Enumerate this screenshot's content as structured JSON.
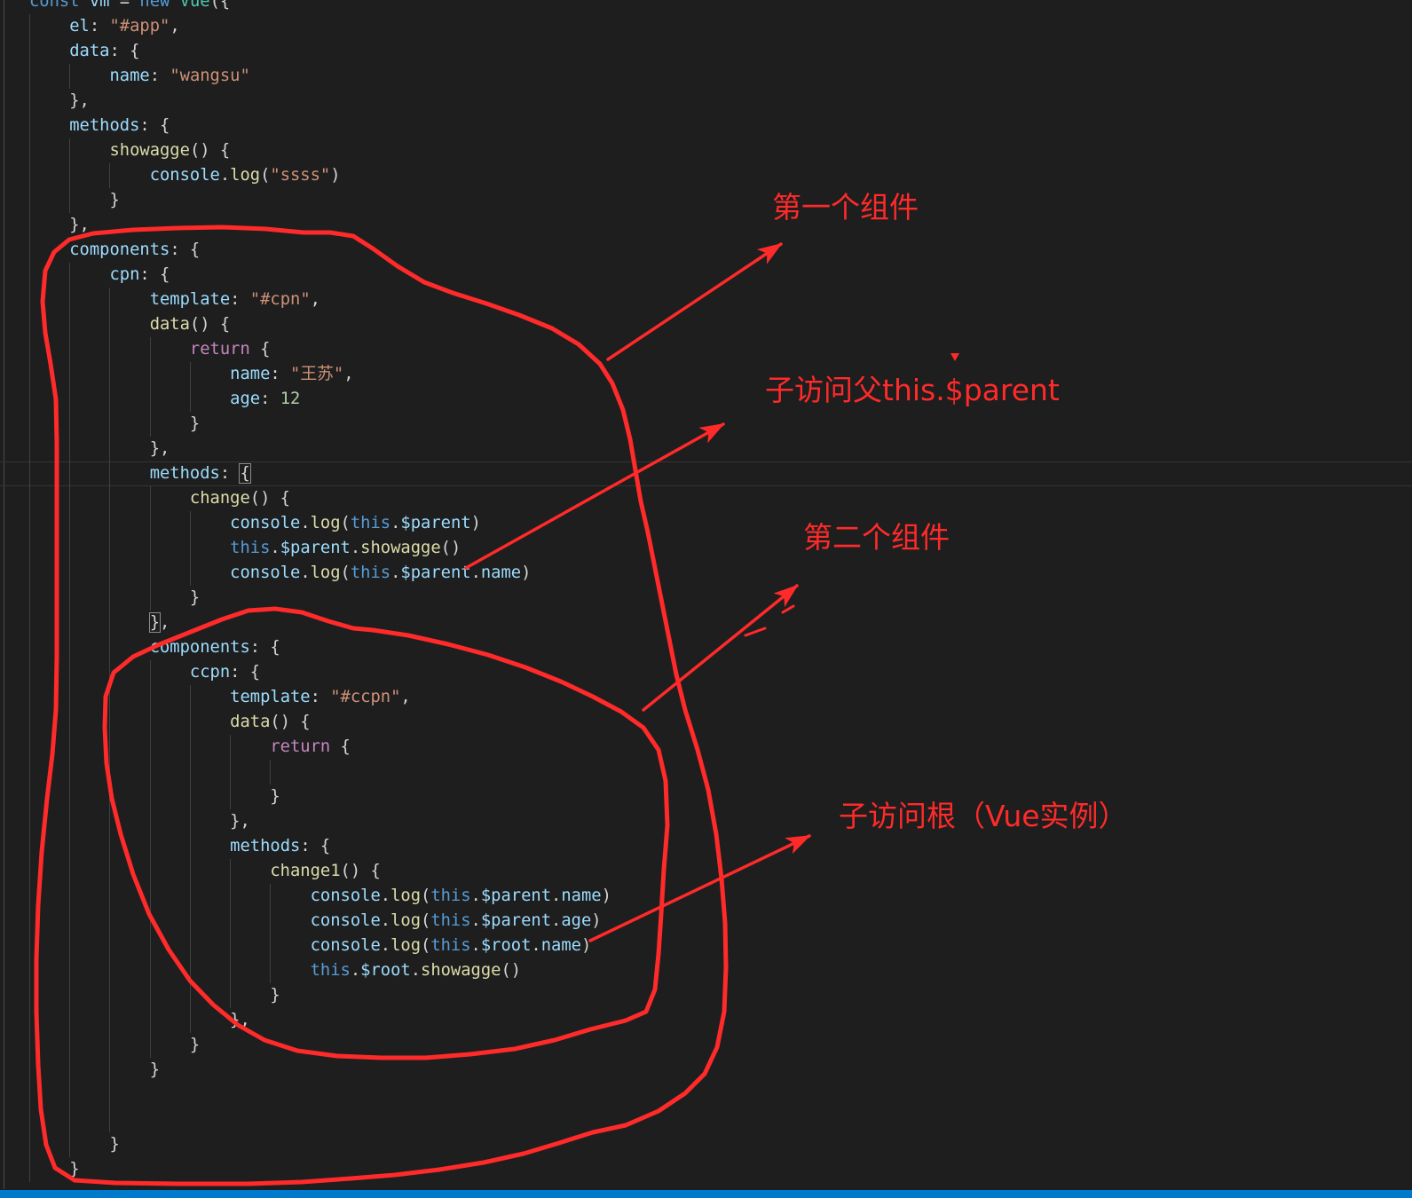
{
  "editor": {
    "theme": {
      "background": "#1e1e1e",
      "keyword": "#569cd6",
      "control": "#c586c0",
      "variable": "#9cdcfe",
      "function": "#dcdcaa",
      "string": "#ce9178",
      "number": "#b5cea8",
      "class": "#4ec9b0",
      "punctuation": "#d4d4d4",
      "indent_guide": "#404040",
      "status_bar": "#007acc"
    },
    "lines": [
      {
        "tokens": [
          {
            "k": "const"
          },
          {
            "p": " "
          },
          {
            "v": "vm"
          },
          {
            "p": " = "
          },
          {
            "k": "new"
          },
          {
            "p": " "
          },
          {
            "cl": "Vue"
          },
          {
            "p": "({"
          }
        ]
      },
      {
        "tokens": [
          {
            "w": "    "
          },
          {
            "v": "el"
          },
          {
            "p": ": "
          },
          {
            "s": "\"#app\""
          },
          {
            "p": ","
          }
        ]
      },
      {
        "tokens": [
          {
            "w": "    "
          },
          {
            "v": "data"
          },
          {
            "p": ": {"
          }
        ]
      },
      {
        "tokens": [
          {
            "w": "        "
          },
          {
            "v": "name"
          },
          {
            "p": ": "
          },
          {
            "s": "\"wangsu\""
          }
        ]
      },
      {
        "tokens": [
          {
            "w": "    "
          },
          {
            "p": "},"
          }
        ]
      },
      {
        "tokens": [
          {
            "w": "    "
          },
          {
            "v": "methods"
          },
          {
            "p": ": {"
          }
        ]
      },
      {
        "tokens": [
          {
            "w": "        "
          },
          {
            "f": "showagge"
          },
          {
            "p": "() {"
          }
        ]
      },
      {
        "tokens": [
          {
            "w": "            "
          },
          {
            "v": "console"
          },
          {
            "p": "."
          },
          {
            "f": "log"
          },
          {
            "p": "("
          },
          {
            "s": "\"ssss\""
          },
          {
            "p": ")"
          }
        ]
      },
      {
        "tokens": [
          {
            "w": "        "
          },
          {
            "p": "}"
          }
        ]
      },
      {
        "tokens": [
          {
            "w": "    "
          },
          {
            "p": "},"
          }
        ]
      },
      {
        "tokens": [
          {
            "w": "    "
          },
          {
            "v": "components"
          },
          {
            "p": ": {"
          }
        ]
      },
      {
        "tokens": [
          {
            "w": "        "
          },
          {
            "v": "cpn"
          },
          {
            "p": ": {"
          }
        ]
      },
      {
        "tokens": [
          {
            "w": "            "
          },
          {
            "v": "template"
          },
          {
            "p": ": "
          },
          {
            "s": "\"#cpn\""
          },
          {
            "p": ","
          }
        ]
      },
      {
        "tokens": [
          {
            "w": "            "
          },
          {
            "f": "data"
          },
          {
            "p": "() {"
          }
        ]
      },
      {
        "tokens": [
          {
            "w": "                "
          },
          {
            "c": "return"
          },
          {
            "p": " {"
          }
        ]
      },
      {
        "tokens": [
          {
            "w": "                    "
          },
          {
            "v": "name"
          },
          {
            "p": ": "
          },
          {
            "s": "\"王苏\""
          },
          {
            "p": ","
          }
        ]
      },
      {
        "tokens": [
          {
            "w": "                    "
          },
          {
            "v": "age"
          },
          {
            "p": ": "
          },
          {
            "n": "12"
          }
        ]
      },
      {
        "tokens": [
          {
            "w": "                "
          },
          {
            "p": "}"
          }
        ]
      },
      {
        "tokens": [
          {
            "w": "            "
          },
          {
            "p": "},"
          }
        ]
      },
      {
        "tokens": [
          {
            "w": "            "
          },
          {
            "v": "methods"
          },
          {
            "p": ": "
          },
          {
            "b": "{"
          }
        ],
        "active": true
      },
      {
        "tokens": [
          {
            "w": "                "
          },
          {
            "f": "change"
          },
          {
            "p": "() {"
          }
        ]
      },
      {
        "tokens": [
          {
            "w": "                    "
          },
          {
            "v": "console"
          },
          {
            "p": "."
          },
          {
            "f": "log"
          },
          {
            "p": "("
          },
          {
            "k": "this"
          },
          {
            "p": "."
          },
          {
            "v": "$parent"
          },
          {
            "p": ")"
          }
        ]
      },
      {
        "tokens": [
          {
            "w": "                    "
          },
          {
            "k": "this"
          },
          {
            "p": "."
          },
          {
            "v": "$parent"
          },
          {
            "p": "."
          },
          {
            "f": "showagge"
          },
          {
            "p": "()"
          }
        ]
      },
      {
        "tokens": [
          {
            "w": "                    "
          },
          {
            "v": "console"
          },
          {
            "p": "."
          },
          {
            "f": "log"
          },
          {
            "p": "("
          },
          {
            "k": "this"
          },
          {
            "p": "."
          },
          {
            "v": "$parent"
          },
          {
            "p": "."
          },
          {
            "v": "name"
          },
          {
            "p": ")"
          }
        ]
      },
      {
        "tokens": [
          {
            "w": "                "
          },
          {
            "p": "}"
          }
        ]
      },
      {
        "tokens": [
          {
            "w": "            "
          },
          {
            "b": "}"
          },
          {
            "p": ","
          }
        ]
      },
      {
        "tokens": [
          {
            "w": "            "
          },
          {
            "v": "components"
          },
          {
            "p": ": {"
          }
        ]
      },
      {
        "tokens": [
          {
            "w": "                "
          },
          {
            "v": "ccpn"
          },
          {
            "p": ": {"
          }
        ]
      },
      {
        "tokens": [
          {
            "w": "                    "
          },
          {
            "v": "template"
          },
          {
            "p": ": "
          },
          {
            "s": "\"#ccpn\""
          },
          {
            "p": ","
          }
        ]
      },
      {
        "tokens": [
          {
            "w": "                    "
          },
          {
            "f": "data"
          },
          {
            "p": "() {"
          }
        ]
      },
      {
        "tokens": [
          {
            "w": "                        "
          },
          {
            "c": "return"
          },
          {
            "p": " {"
          }
        ]
      },
      {
        "tokens": []
      },
      {
        "tokens": [
          {
            "w": "                        "
          },
          {
            "p": "}"
          }
        ]
      },
      {
        "tokens": [
          {
            "w": "                    "
          },
          {
            "p": "},"
          }
        ]
      },
      {
        "tokens": [
          {
            "w": "                    "
          },
          {
            "v": "methods"
          },
          {
            "p": ": {"
          }
        ]
      },
      {
        "tokens": [
          {
            "w": "                        "
          },
          {
            "f": "change1"
          },
          {
            "p": "() {"
          }
        ]
      },
      {
        "tokens": [
          {
            "w": "                            "
          },
          {
            "v": "console"
          },
          {
            "p": "."
          },
          {
            "f": "log"
          },
          {
            "p": "("
          },
          {
            "k": "this"
          },
          {
            "p": "."
          },
          {
            "v": "$parent"
          },
          {
            "p": "."
          },
          {
            "v": "name"
          },
          {
            "p": ")"
          }
        ]
      },
      {
        "tokens": [
          {
            "w": "                            "
          },
          {
            "v": "console"
          },
          {
            "p": "."
          },
          {
            "f": "log"
          },
          {
            "p": "("
          },
          {
            "k": "this"
          },
          {
            "p": "."
          },
          {
            "v": "$parent"
          },
          {
            "p": "."
          },
          {
            "v": "age"
          },
          {
            "p": ")"
          }
        ]
      },
      {
        "tokens": [
          {
            "w": "                            "
          },
          {
            "v": "console"
          },
          {
            "p": "."
          },
          {
            "f": "log"
          },
          {
            "p": "("
          },
          {
            "k": "this"
          },
          {
            "p": "."
          },
          {
            "v": "$root"
          },
          {
            "p": "."
          },
          {
            "v": "name"
          },
          {
            "p": ")"
          }
        ]
      },
      {
        "tokens": [
          {
            "w": "                            "
          },
          {
            "k": "this"
          },
          {
            "p": "."
          },
          {
            "v": "$root"
          },
          {
            "p": "."
          },
          {
            "f": "showagge"
          },
          {
            "p": "()"
          }
        ]
      },
      {
        "tokens": [
          {
            "w": "                        "
          },
          {
            "p": "}"
          }
        ]
      },
      {
        "tokens": [
          {
            "w": "                    "
          },
          {
            "p": "},"
          }
        ]
      },
      {
        "tokens": [
          {
            "w": "                "
          },
          {
            "p": "}"
          }
        ]
      },
      {
        "tokens": [
          {
            "w": "            "
          },
          {
            "p": "}"
          }
        ]
      },
      {
        "tokens": []
      },
      {
        "tokens": []
      },
      {
        "tokens": [
          {
            "w": "        "
          },
          {
            "p": "}"
          }
        ]
      },
      {
        "tokens": [
          {
            "w": "    "
          },
          {
            "p": "}"
          }
        ]
      }
    ]
  },
  "annotations": {
    "color": "#ff2a2a",
    "labels": {
      "first_component": "第一个组件",
      "child_access_parent": "子访问父this.$parent",
      "second_component": "第二个组件",
      "child_access_root": "子访问根（Vue实例）"
    }
  }
}
